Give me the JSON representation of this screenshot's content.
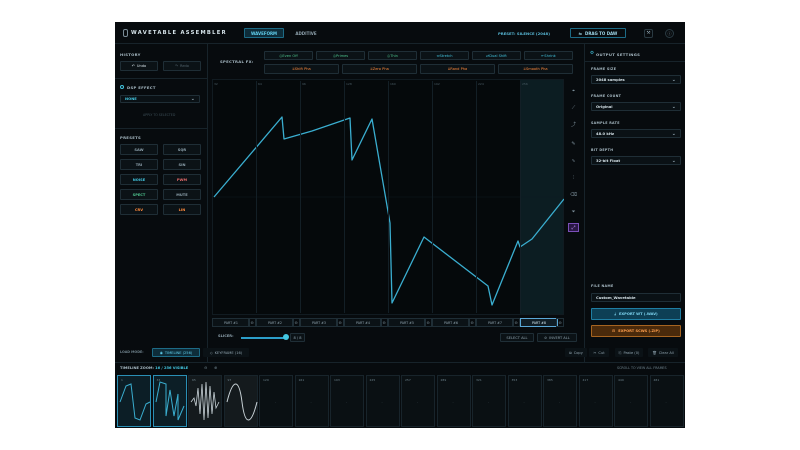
{
  "header": {
    "title": "WAVETABLE ASSEMBLER",
    "tabs": [
      {
        "label": "WAVEFORM",
        "active": true
      },
      {
        "label": "ADDITIVE",
        "active": false
      }
    ],
    "preset": "PRESET: SILENCE (2048)",
    "drag_label": "DRAG TO DAW"
  },
  "history": {
    "label": "HISTORY",
    "undo": "Undo",
    "redo": "Redo"
  },
  "dsp": {
    "label": "DSP EFFECT",
    "select_value": "NONE",
    "apply": "APPLY TO SELECTED"
  },
  "presets": {
    "label": "PRESETS",
    "items": [
      {
        "label": "SAW",
        "color": "#8fa3ae"
      },
      {
        "label": "SQR",
        "color": "#8fa3ae"
      },
      {
        "label": "TRI",
        "color": "#8fa3ae"
      },
      {
        "label": "SIN",
        "color": "#8fa3ae"
      },
      {
        "label": "NOISE",
        "color": "#43c6e0"
      },
      {
        "label": "PWM",
        "color": "#e66b6b"
      },
      {
        "label": "SPECT",
        "color": "#4ec48e"
      },
      {
        "label": "MUTE",
        "color": "#8fa3ae"
      },
      {
        "label": "CRV",
        "color": "#ff8a3d"
      },
      {
        "label": "LIN",
        "color": "#ff8a3d"
      }
    ]
  },
  "spectral": {
    "label": "SPECTRAL FX:",
    "row1": [
      "Even Off",
      "Primes",
      "Thin",
      "Stretch",
      "Dual Shift",
      "Shrink"
    ],
    "row2": [
      "Shift Pha",
      "Zero Pha",
      "Rand Pha",
      "Smooth Pha"
    ]
  },
  "grid": {
    "column_markers": [
      "32",
      "64",
      "96",
      "128",
      "160",
      "192",
      "224",
      "256"
    ]
  },
  "parts": {
    "labels": [
      "PART #1",
      "PART #2",
      "PART #3",
      "PART #4",
      "PART #5",
      "PART #6",
      "PART #7",
      "PART #8"
    ],
    "active_index": 7
  },
  "slicer": {
    "label": "SLICER:",
    "value": "8 / 8",
    "fraction": 1.0,
    "select_all": "SELECT ALL",
    "invert_all": "INVERT ALL"
  },
  "output": {
    "title": "OUTPUT SETTINGS",
    "frame_size_label": "FRAME SIZE",
    "frame_size": "2048 samples",
    "frame_count_label": "FRAME COUNT",
    "frame_count": "Original",
    "sample_rate_label": "SAMPLE RATE",
    "sample_rate": "48.0 kHz",
    "bit_depth_label": "BIT DEPTH",
    "bit_depth": "32-bit Float",
    "file_name_label": "FILE NAME",
    "file_name": "Custom_Wavetable",
    "export_wav": "EXPORT WT (.WAV)",
    "export_serum": "EXPORT SCWS (.ZIP)"
  },
  "bottom": {
    "load_mode": "LOAD MODE:",
    "timeline": "TIMELINE (256)",
    "keyframe": "KEYFRAME (16)",
    "copy": "Copy",
    "cut": "Cut",
    "paste": "Paste (0)",
    "clear": "Clear All",
    "zoom_label": "TIMELINE ZOOM:",
    "zoom_value": "16 / 256 VISIBLE",
    "scroll_hint": "SCROLL TO VIEW ALL FRAMES",
    "frame_numbers": [
      "1",
      "33",
      "65",
      "97",
      "129",
      "161",
      "193",
      "225",
      "257",
      "289",
      "321",
      "353",
      "385",
      "417",
      "449",
      "481"
    ]
  },
  "colors": {
    "accent": "#3fb7d6",
    "waveform": "#3aaed0",
    "background": "#070b0e",
    "export_wav": "#0d3f55",
    "export_serum": "#4a2a0b"
  }
}
